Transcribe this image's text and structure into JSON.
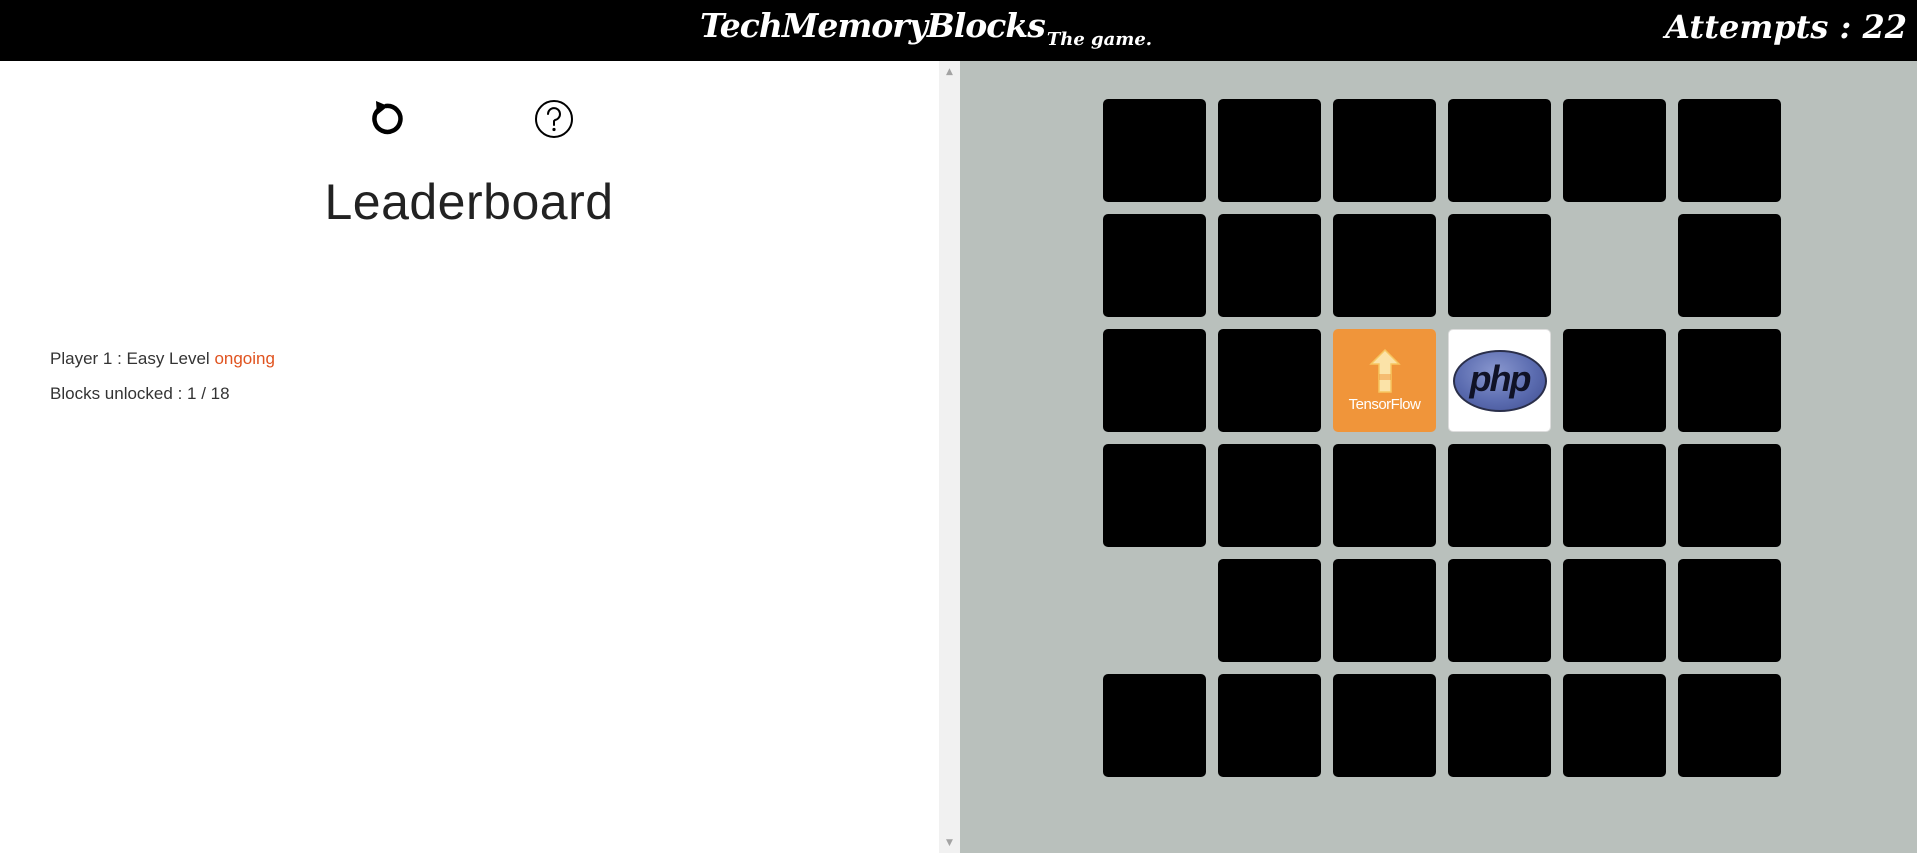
{
  "header": {
    "title": "TechMemoryBlocks",
    "subtitle": "The game.",
    "attempts_label": "Attempts : 22"
  },
  "sidebar": {
    "reload_icon": "reload-icon",
    "help_icon": "help-icon",
    "leaderboard_title": "Leaderboard",
    "player_text": "Player 1 : Easy Level",
    "player_status": "ongoing",
    "blocks_unlocked_text": "Blocks unlocked : 1 / 18"
  },
  "colors": {
    "header_bg": "#000000",
    "board_bg": "#b9c0bc",
    "block_hidden": "#000000",
    "status_ongoing": "#e0531f",
    "tensorflow_bg": "#f0953a"
  },
  "board": {
    "columns": 6,
    "rows": 6,
    "cells": [
      {
        "state": "hidden"
      },
      {
        "state": "hidden"
      },
      {
        "state": "hidden"
      },
      {
        "state": "hidden"
      },
      {
        "state": "hidden"
      },
      {
        "state": "hidden"
      },
      {
        "state": "hidden"
      },
      {
        "state": "hidden"
      },
      {
        "state": "hidden"
      },
      {
        "state": "hidden"
      },
      {
        "state": "removed"
      },
      {
        "state": "hidden"
      },
      {
        "state": "hidden"
      },
      {
        "state": "hidden"
      },
      {
        "state": "flipped",
        "tech": "TensorFlow"
      },
      {
        "state": "flipped",
        "tech": "php"
      },
      {
        "state": "hidden"
      },
      {
        "state": "hidden"
      },
      {
        "state": "hidden"
      },
      {
        "state": "hidden"
      },
      {
        "state": "hidden"
      },
      {
        "state": "hidden"
      },
      {
        "state": "hidden"
      },
      {
        "state": "hidden"
      },
      {
        "state": "removed"
      },
      {
        "state": "hidden"
      },
      {
        "state": "hidden"
      },
      {
        "state": "hidden"
      },
      {
        "state": "hidden"
      },
      {
        "state": "hidden"
      },
      {
        "state": "hidden"
      },
      {
        "state": "hidden"
      },
      {
        "state": "hidden"
      },
      {
        "state": "hidden"
      },
      {
        "state": "hidden"
      },
      {
        "state": "hidden"
      }
    ]
  }
}
